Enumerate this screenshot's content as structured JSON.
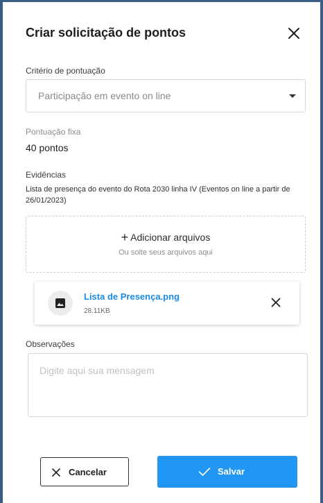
{
  "modal": {
    "title": "Criar solicitação de pontos"
  },
  "criteria": {
    "label": "Critério de pontuação",
    "selected_value": "Participação em evento on line"
  },
  "fixed_points": {
    "label": "Pontuação fixa",
    "value": "40 pontos"
  },
  "evidence": {
    "label": "Evidências",
    "description": "Lista de presença do evento do Rota 2030 linha IV (Eventos on line a partir de 26/01/2023)"
  },
  "dropzone": {
    "add_label": "Adicionar arquivos",
    "hint": "Ou solte seus arquivos aqui"
  },
  "file": {
    "name": "Lista de Presença.png",
    "size": "28.11KB",
    "icon": "image-icon"
  },
  "observations": {
    "label": "Observações",
    "placeholder": "Digite aqui sua mensagem"
  },
  "actions": {
    "cancel_label": "Cancelar",
    "save_label": "Salvar"
  },
  "colors": {
    "primary": "#2196f3",
    "link": "#1a8be5",
    "frame_border": "#3a5d86"
  }
}
